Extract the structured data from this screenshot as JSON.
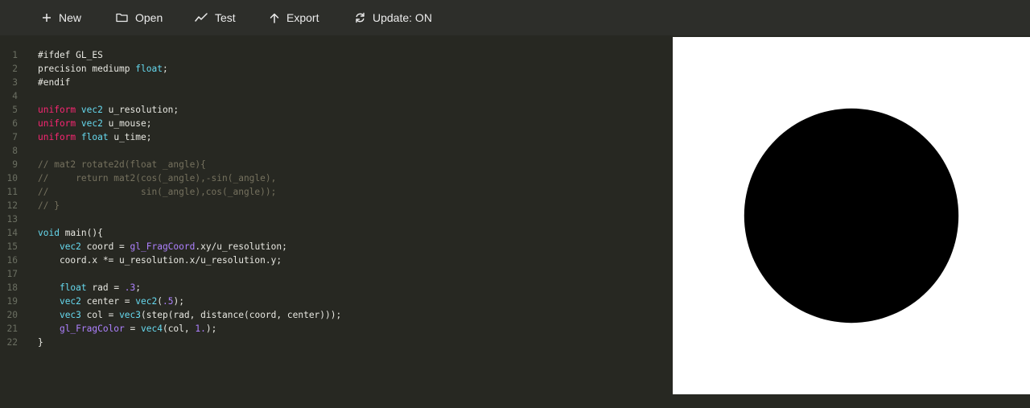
{
  "toolbar": {
    "new_label": "New",
    "open_label": "Open",
    "test_label": "Test",
    "export_label": "Export",
    "update_label": "Update: ON"
  },
  "editor": {
    "line_numbers": [
      "1",
      "2",
      "3",
      "4",
      "5",
      "6",
      "7",
      "8",
      "9",
      "10",
      "11",
      "12",
      "13",
      "14",
      "15",
      "16",
      "17",
      "18",
      "19",
      "20",
      "21",
      "22"
    ],
    "lines": [
      [
        [
          "pp",
          "#ifdef GL_ES"
        ]
      ],
      [
        [
          "tx",
          "precision mediump "
        ],
        [
          "ty",
          "float"
        ],
        [
          "tx",
          ";"
        ]
      ],
      [
        [
          "pp",
          "#endif"
        ]
      ],
      [],
      [
        [
          "kw",
          "uniform"
        ],
        [
          "tx",
          " "
        ],
        [
          "ty",
          "vec2"
        ],
        [
          "tx",
          " u_resolution;"
        ]
      ],
      [
        [
          "kw",
          "uniform"
        ],
        [
          "tx",
          " "
        ],
        [
          "ty",
          "vec2"
        ],
        [
          "tx",
          " u_mouse;"
        ]
      ],
      [
        [
          "kw",
          "uniform"
        ],
        [
          "tx",
          " "
        ],
        [
          "ty",
          "float"
        ],
        [
          "tx",
          " u_time;"
        ]
      ],
      [],
      [
        [
          "cm",
          "// mat2 rotate2d(float _angle){"
        ]
      ],
      [
        [
          "cm",
          "//     return mat2(cos(_angle),-sin(_angle),"
        ]
      ],
      [
        [
          "cm",
          "//                 sin(_angle),cos(_angle));"
        ]
      ],
      [
        [
          "cm",
          "// }"
        ]
      ],
      [],
      [
        [
          "ty",
          "void"
        ],
        [
          "tx",
          " main(){"
        ]
      ],
      [
        [
          "tx",
          "    "
        ],
        [
          "ty",
          "vec2"
        ],
        [
          "tx",
          " coord = "
        ],
        [
          "bi",
          "gl_FragCoord"
        ],
        [
          "tx",
          ".xy/u_resolution;"
        ]
      ],
      [
        [
          "tx",
          "    coord.x *= u_resolution.x/u_resolution.y;"
        ]
      ],
      [],
      [
        [
          "tx",
          "    "
        ],
        [
          "ty",
          "float"
        ],
        [
          "tx",
          " rad = "
        ],
        [
          "nm",
          ".3"
        ],
        [
          "tx",
          ";"
        ]
      ],
      [
        [
          "tx",
          "    "
        ],
        [
          "ty",
          "vec2"
        ],
        [
          "tx",
          " center = "
        ],
        [
          "ty",
          "vec2"
        ],
        [
          "tx",
          "("
        ],
        [
          "nm",
          ".5"
        ],
        [
          "tx",
          ");"
        ]
      ],
      [
        [
          "tx",
          "    "
        ],
        [
          "ty",
          "vec3"
        ],
        [
          "tx",
          " col = "
        ],
        [
          "ty",
          "vec3"
        ],
        [
          "tx",
          "(step(rad, distance(coord, center)));"
        ]
      ],
      [
        [
          "tx",
          "    "
        ],
        [
          "bi",
          "gl_FragColor"
        ],
        [
          "tx",
          " = "
        ],
        [
          "ty",
          "vec4"
        ],
        [
          "tx",
          "(col, "
        ],
        [
          "nm",
          "1."
        ],
        [
          "tx",
          ");"
        ]
      ],
      [
        [
          "tx",
          "}"
        ]
      ]
    ]
  },
  "preview": {
    "background_color": "#ffffff",
    "shape_color": "#000000",
    "circle_center": 0.5,
    "circle_radius": 0.3
  },
  "colors": {
    "background": "#272822",
    "toolbar": "#2d2e2a",
    "keyword": "#f92672",
    "type": "#66d9ef",
    "builtin": "#ae81ff",
    "comment": "#75715e",
    "text": "#e8e8e2"
  }
}
